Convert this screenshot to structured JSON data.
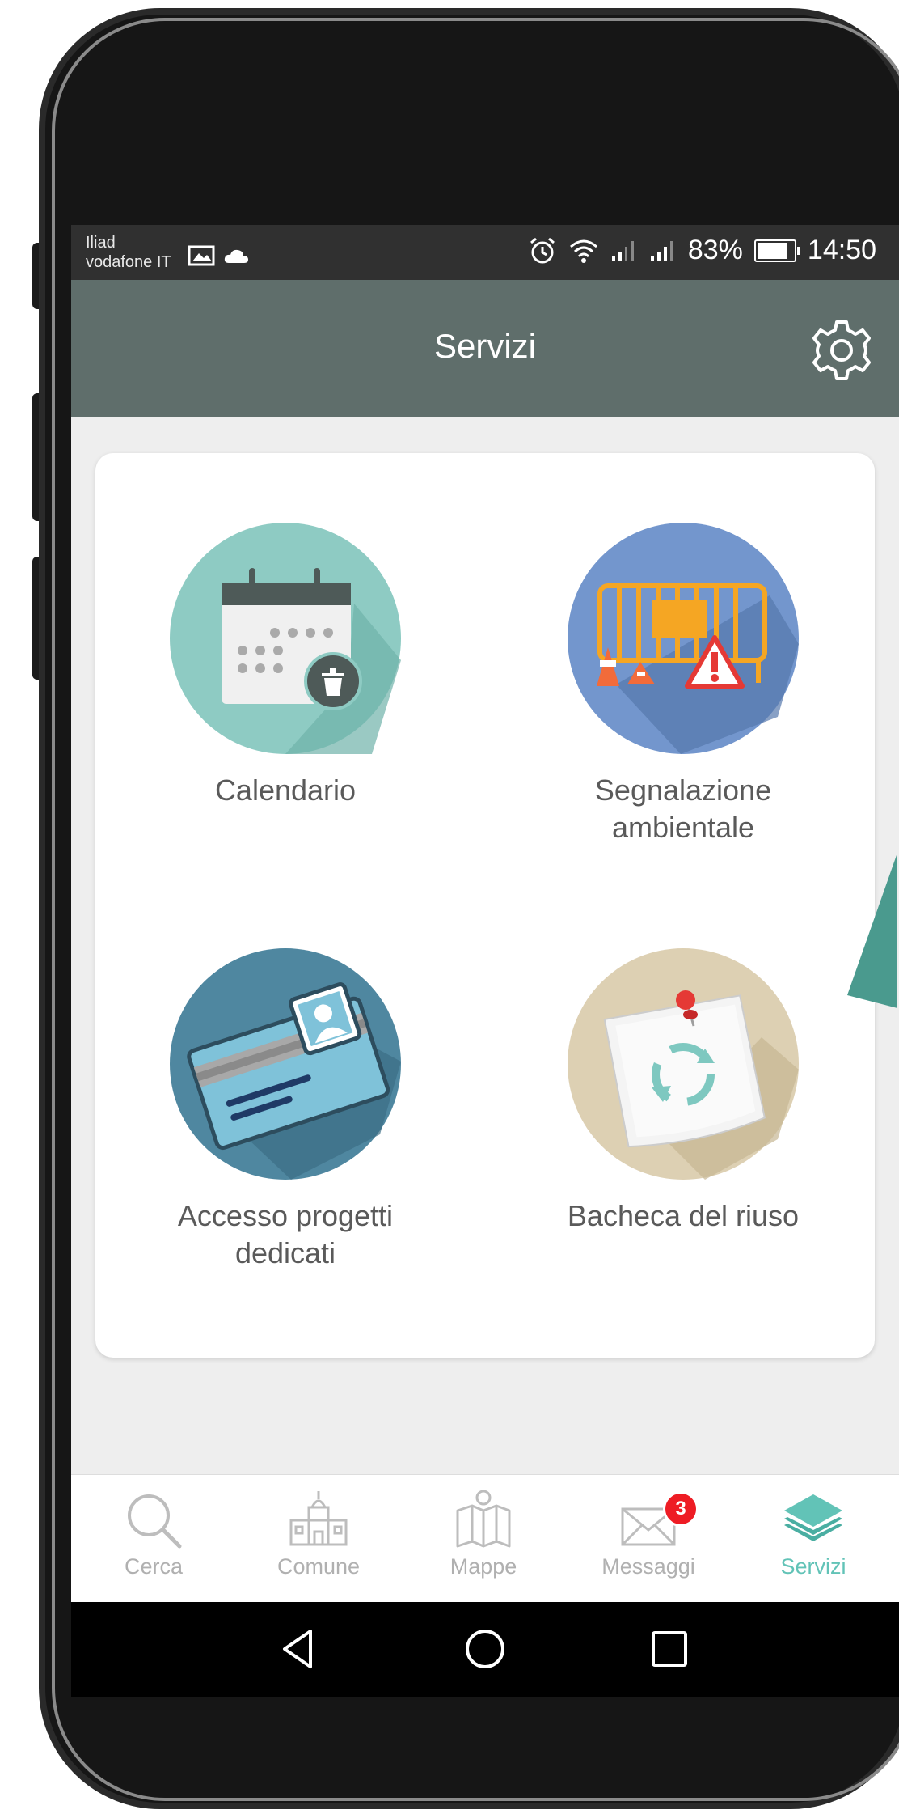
{
  "status_bar": {
    "carrier_line1": "Iliad",
    "carrier_line2": "vodafone IT",
    "notification_icons": [
      "gallery-icon",
      "cloud-icon"
    ],
    "right_icons": [
      "alarm-icon",
      "wifi-icon",
      "signal-icon",
      "signal-icon"
    ],
    "battery_text": "83%",
    "battery_level": 0.83,
    "time": "14:50"
  },
  "app_bar": {
    "title": "Servizi",
    "settings_icon": "gear-icon"
  },
  "services": [
    {
      "label": "Calendario",
      "icon": "calendar-icon",
      "color": "#8ecbc3"
    },
    {
      "label": "Segnalazione ambientale",
      "icon": "barrier-warning-icon",
      "color": "#7396cd"
    },
    {
      "label": "Accesso progetti dedicati",
      "icon": "id-card-icon",
      "color": "#4f87a0"
    },
    {
      "label": "Bacheca del riuso",
      "icon": "pinned-note-recycle-icon",
      "color": "#ddd0b3"
    }
  ],
  "bottom_nav": {
    "items": [
      {
        "label": "Cerca",
        "icon": "search-icon"
      },
      {
        "label": "Comune",
        "icon": "town-hall-icon"
      },
      {
        "label": "Mappe",
        "icon": "map-icon"
      },
      {
        "label": "Messaggi",
        "icon": "envelope-icon",
        "badge": "3"
      },
      {
        "label": "Servizi",
        "icon": "layers-icon",
        "active": true
      }
    ]
  },
  "system_nav": [
    "back-icon",
    "home-icon",
    "recents-icon"
  ],
  "colors": {
    "appbar": "#5f6e6b",
    "accent": "#62c3b7",
    "badge": "#ee1c24",
    "arrow": "#4a9a8e"
  }
}
